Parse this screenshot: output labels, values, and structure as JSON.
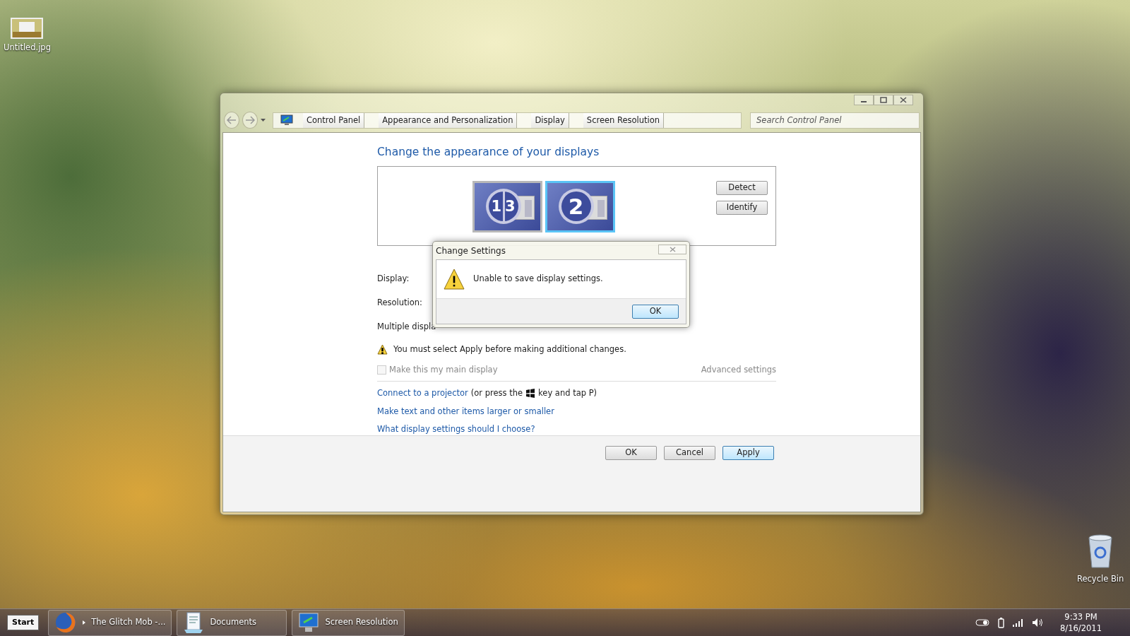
{
  "desktop": {
    "icons": [
      {
        "label": "Untitled.jpg",
        "kind": "image"
      },
      {
        "label": "Recycle Bin",
        "kind": "recycle"
      }
    ]
  },
  "window": {
    "breadcrumbs": [
      "Control Panel",
      "Appearance and Personalization",
      "Display",
      "Screen Resolution"
    ],
    "search": {
      "placeholder": "Search Control Panel"
    },
    "heading": "Change the appearance of your displays",
    "monitors": [
      {
        "numbers": [
          "1",
          "3"
        ],
        "selected": false
      },
      {
        "numbers": [
          "2"
        ],
        "selected": true
      }
    ],
    "monitor_buttons": [
      "Detect",
      "Identify"
    ],
    "fields": [
      "Display:",
      "Resolution:",
      "Multiple displa"
    ],
    "warning": "You must select Apply before making additional changes.",
    "main_display": {
      "label": "Make this my main display",
      "checked": false,
      "disabled": true
    },
    "advanced": {
      "label": "Advanced settings",
      "disabled": true
    },
    "links": [
      {
        "text": "Connect to a projector",
        "note_before": "(or press the",
        "note_after": "key and tap P)"
      },
      {
        "text": "Make text and other items larger or smaller"
      },
      {
        "text": "What display settings should I choose?"
      }
    ],
    "buttons": [
      {
        "label": "OK",
        "focused": false
      },
      {
        "label": "Cancel",
        "focused": false
      },
      {
        "label": "Apply",
        "focused": true
      }
    ]
  },
  "dialog": {
    "title": "Change Settings",
    "message": "Unable to save display settings.",
    "buttons": [
      {
        "label": "OK",
        "focused": true
      }
    ]
  },
  "taskbar": {
    "start": "Start",
    "tasks": [
      {
        "label": "The Glitch Mob -...",
        "kind": "browser"
      },
      {
        "label": "Documents",
        "kind": "documents"
      },
      {
        "label": "Screen Resolution",
        "kind": "display"
      }
    ],
    "clock": {
      "time": "9:33 PM",
      "date": "8/16/2011"
    }
  }
}
